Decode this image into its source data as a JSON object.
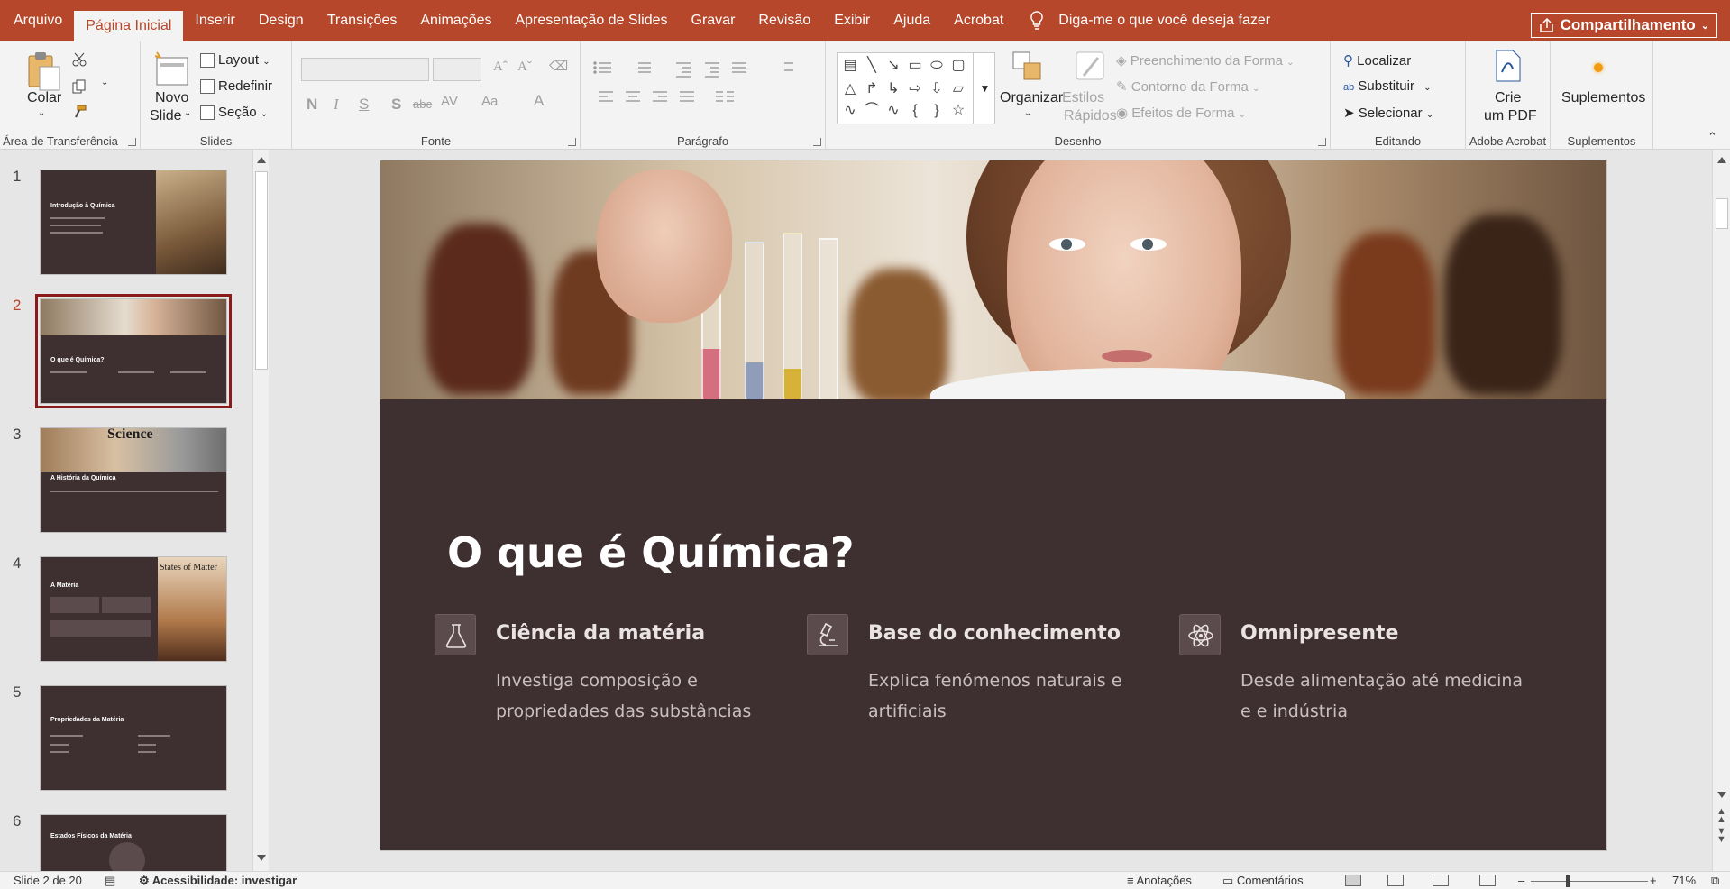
{
  "menu": {
    "tabs": [
      "Arquivo",
      "Página Inicial",
      "Inserir",
      "Design",
      "Transições",
      "Animações",
      "Apresentação de Slides",
      "Gravar",
      "Revisão",
      "Exibir",
      "Ajuda",
      "Acrobat"
    ],
    "active_tab": "Página Inicial",
    "tell_me": "Diga-me o que você deseja fazer",
    "share": "Compartilhamento"
  },
  "ribbon": {
    "clipboard": {
      "paste": "Colar",
      "label": "Área de Transferência"
    },
    "slides": {
      "new_slide_1": "Novo",
      "new_slide_2": "Slide",
      "layout": "Layout",
      "reset": "Redefinir",
      "section": "Seção",
      "label": "Slides"
    },
    "font": {
      "bold": "N",
      "italic": "I",
      "underline": "S",
      "shadow": "S",
      "strike": "abc",
      "label": "Fonte"
    },
    "paragraph": {
      "label": "Parágrafo"
    },
    "drawing": {
      "arrange": "Organizar",
      "quick_styles_1": "Estilos",
      "quick_styles_2": "Rápidos",
      "fill": "Preenchimento da Forma",
      "outline": "Contorno da Forma",
      "effects": "Efeitos de Forma",
      "label": "Desenho"
    },
    "editing": {
      "find": "Localizar",
      "replace": "Substituir",
      "select": "Selecionar",
      "label": "Editando"
    },
    "acrobat": {
      "create_pdf_1": "Crie",
      "create_pdf_2": "um PDF",
      "label": "Adobe Acrobat"
    },
    "addins": {
      "addins": "Suplementos",
      "label": "Suplementos"
    }
  },
  "thumbnails": [
    {
      "num": "1",
      "title": "Introdução à Química",
      "selected": false
    },
    {
      "num": "2",
      "title": "O que é Química?",
      "selected": true
    },
    {
      "num": "3",
      "title": "A História da Química",
      "image_text": "Science",
      "selected": false
    },
    {
      "num": "4",
      "title": "A Matéria",
      "image_text": "States of Matter",
      "selected": false
    },
    {
      "num": "5",
      "title": "Propriedades da Matéria",
      "selected": false
    },
    {
      "num": "6",
      "title": "Estados Físicos da Matéria",
      "selected": false
    }
  ],
  "slide": {
    "title": "O que é Química?",
    "features": [
      {
        "icon": "flask-icon",
        "heading": "Ciência da matéria",
        "text": "Investiga composição e propriedades das substâncias"
      },
      {
        "icon": "microscope-icon",
        "heading": "Base do conhecimento",
        "text": "Explica fenómenos naturais e artificiais"
      },
      {
        "icon": "atom-icon",
        "heading": "Omnipresente",
        "text": "Desde alimentação até medicina e e indústria"
      }
    ]
  },
  "status": {
    "slide_count": "Slide 2 de 20",
    "accessibility": "Acessibilidade: investigar",
    "notes": "Anotações",
    "comments": "Comentários",
    "zoom": "71%"
  },
  "colors": {
    "brand": "#b7472a",
    "slide_bg": "#3e2f31"
  }
}
